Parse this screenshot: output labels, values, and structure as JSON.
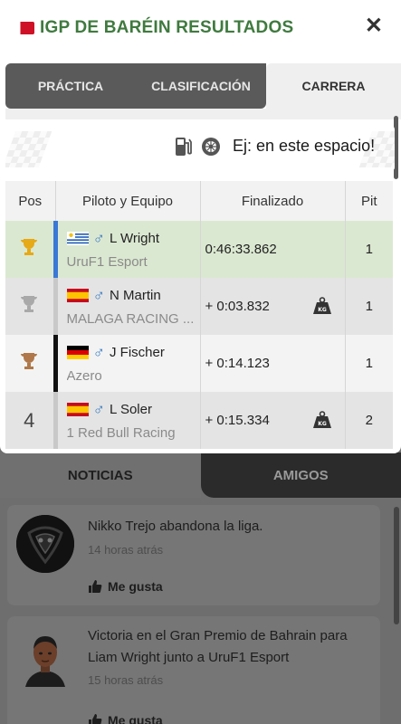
{
  "header": {
    "title": "IGP DE BARÉIN RESULTADOS",
    "close_icon": "close-icon"
  },
  "tabs": [
    {
      "label": "PRÁCTICA",
      "active": false
    },
    {
      "label": "CLASIFICACIÓN",
      "active": false
    },
    {
      "label": "CARRERA",
      "active": true
    }
  ],
  "search": {
    "placeholder": "Ej: en este espacio!"
  },
  "table": {
    "headers": [
      "Pos",
      "Piloto y Equipo",
      "Finalizado",
      "Pit"
    ],
    "rows": [
      {
        "pos_icon": "gold-trophy-icon",
        "pos": "",
        "flag": "uruguay",
        "driver": "L Wright",
        "team": "UruF1 Esport",
        "finish": "0:46:33.862",
        "penalty": false,
        "pit": "1",
        "team_color": "#3a78d6"
      },
      {
        "pos_icon": "silver-trophy-icon",
        "pos": "",
        "flag": "spain",
        "driver": "N Martin",
        "team": "MALAGA RACING ...",
        "finish": "+ 0:03.832",
        "penalty": true,
        "pit": "1",
        "team_color": "#c8c8c8"
      },
      {
        "pos_icon": "bronze-trophy-icon",
        "pos": "",
        "flag": "germany",
        "driver": "J Fischer",
        "team": "Azero",
        "finish": "+ 0:14.123",
        "penalty": false,
        "pit": "1",
        "team_color": "#111111"
      },
      {
        "pos_icon": "",
        "pos": "4",
        "flag": "spain",
        "driver": "L Soler",
        "team": "1 Red Bull Racing",
        "finish": "+ 0:15.334",
        "penalty": true,
        "pit": "2",
        "team_color": "#c8c8c8"
      }
    ]
  },
  "bottom_tabs": {
    "news": "NOTICIAS",
    "friends": "AMIGOS"
  },
  "feed": [
    {
      "text": "Nikko Trejo abandona la liga.",
      "time": "14 horas atrás",
      "like": "Me gusta"
    },
    {
      "text": "Victoria en el Gran Premio de Bahrain para Liam Wright junto a UruF1 Esport",
      "time": "15 horas atrás",
      "like": "Me gusta"
    }
  ]
}
